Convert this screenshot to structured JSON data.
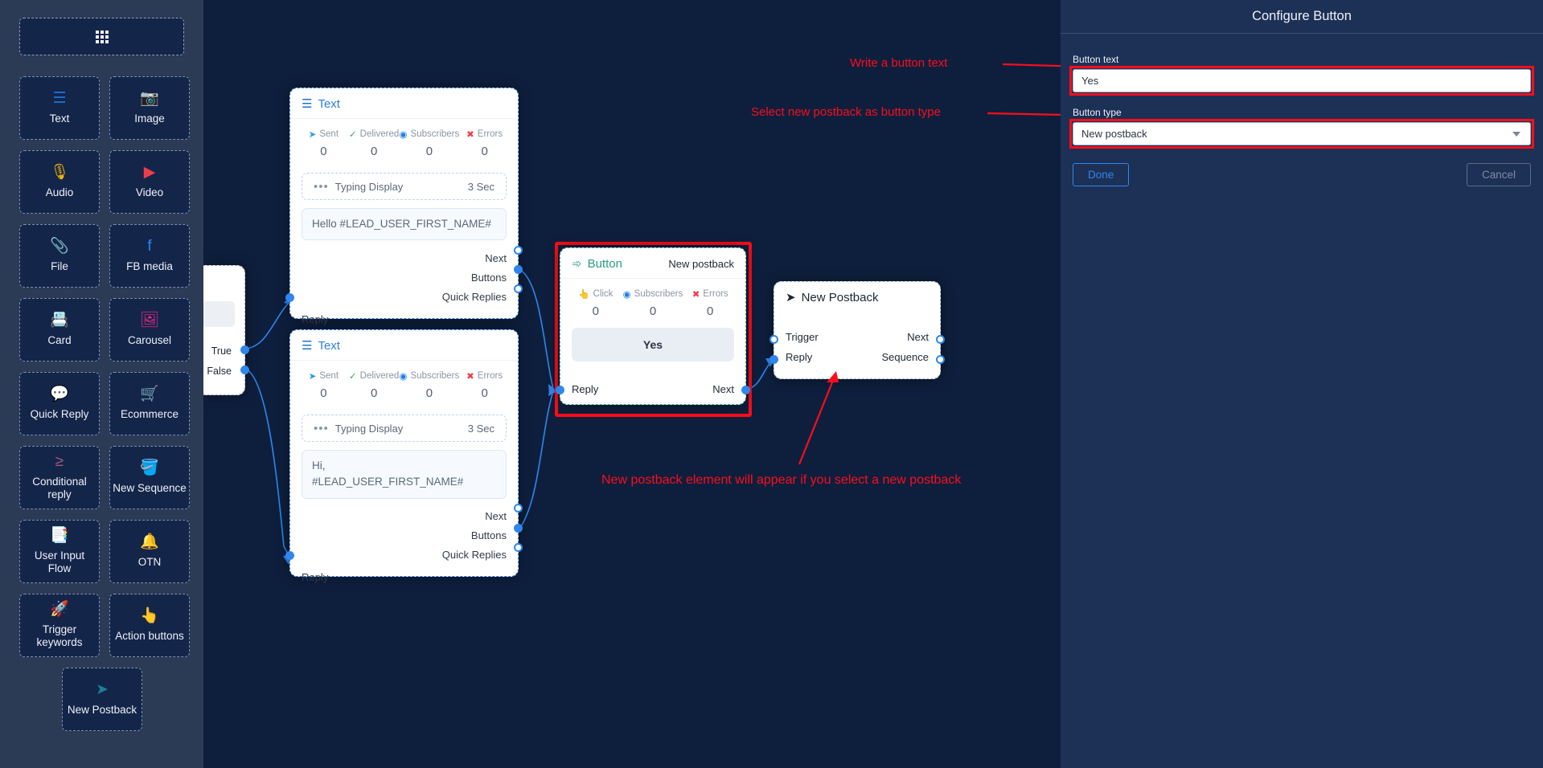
{
  "sidebar": {
    "grid_button_name": "apps-grid-icon",
    "tiles": [
      {
        "label": "Text",
        "icon": "☰",
        "color": "#1f6fd0",
        "name": "text"
      },
      {
        "label": "Image",
        "icon": "📷",
        "color": "#7b2ff7",
        "name": "image"
      },
      {
        "label": "Audio",
        "icon": "🎙",
        "color": "#f5b50a",
        "name": "audio"
      },
      {
        "label": "Video",
        "icon": "▶",
        "color": "#ef3e4a",
        "name": "video"
      },
      {
        "label": "File",
        "icon": "📎",
        "color": "#2fb14d",
        "name": "file"
      },
      {
        "label": "FB media",
        "icon": "f",
        "color": "#1d8bf1",
        "name": "fb-media"
      },
      {
        "label": "Card",
        "icon": "📇",
        "color": "#1fb6c9",
        "name": "card"
      },
      {
        "label": "Carousel",
        "icon": "🖼",
        "color": "#e5267f",
        "name": "carousel"
      },
      {
        "label": "Quick Reply",
        "icon": "💬",
        "color": "#d41f96",
        "name": "quick-reply"
      },
      {
        "label": "Ecommerce",
        "icon": "🛒",
        "color": "#f08008",
        "name": "ecommerce"
      },
      {
        "label": "Conditional reply",
        "icon": "≥",
        "color": "#a4577f",
        "name": "conditional-reply"
      },
      {
        "label": "New Sequence",
        "icon": "🪣",
        "color": "#d8232f",
        "name": "new-sequence"
      },
      {
        "label": "User Input Flow",
        "icon": "📑",
        "color": "#2fcf4d",
        "name": "user-input-flow"
      },
      {
        "label": "OTN",
        "icon": "🔔",
        "color": "#7a6df0",
        "name": "otn"
      },
      {
        "label": "Trigger keywords",
        "icon": "🚀",
        "color": "#1d2ce0",
        "name": "trigger-keywords"
      },
      {
        "label": "Action buttons",
        "icon": "👆",
        "color": "#f4786e",
        "name": "action-buttons"
      },
      {
        "label": "New Postback",
        "icon": "➤",
        "color": "#1d7f93",
        "name": "new-postback"
      }
    ]
  },
  "canvas": {
    "conditional_node": {
      "true_label": "True",
      "false_label": "False"
    },
    "text_node_1": {
      "title": "Text",
      "stats": [
        {
          "label": "Sent",
          "value": "0",
          "icon": "➤",
          "color": "#2f9ae0"
        },
        {
          "label": "Delivered",
          "value": "0",
          "icon": "✓",
          "color": "#2fb14d"
        },
        {
          "label": "Subscribers",
          "value": "0",
          "icon": "◉",
          "color": "#1d7fe0"
        },
        {
          "label": "Errors",
          "value": "0",
          "icon": "✖",
          "color": "#ef3e4a"
        }
      ],
      "typing_label": "Typing Display",
      "typing_value": "3 Sec",
      "message": "Hello #LEAD_USER_FIRST_NAME#",
      "ports_right": [
        "Next",
        "Buttons",
        "Quick Replies"
      ],
      "ports_left": [
        "Reply"
      ]
    },
    "text_node_2": {
      "title": "Text",
      "stats": [
        {
          "label": "Sent",
          "value": "0",
          "icon": "➤",
          "color": "#2f9ae0"
        },
        {
          "label": "Delivered",
          "value": "0",
          "icon": "✓",
          "color": "#2fb14d"
        },
        {
          "label": "Subscribers",
          "value": "0",
          "icon": "◉",
          "color": "#1d7fe0"
        },
        {
          "label": "Errors",
          "value": "0",
          "icon": "✖",
          "color": "#ef3e4a"
        }
      ],
      "typing_label": "Typing Display",
      "typing_value": "3 Sec",
      "message": "Hi,\n#LEAD_USER_FIRST_NAME#",
      "ports_right": [
        "Next",
        "Buttons",
        "Quick Replies"
      ],
      "ports_left": [
        "Reply"
      ]
    },
    "button_node": {
      "title": "Button",
      "badge": "New postback",
      "stats": [
        {
          "label": "Click",
          "value": "0",
          "icon": "👆",
          "color": "#5ab4e8"
        },
        {
          "label": "Subscribers",
          "value": "0",
          "icon": "◉",
          "color": "#1d7fe0"
        },
        {
          "label": "Errors",
          "value": "0",
          "icon": "✖",
          "color": "#ef3e4a"
        }
      ],
      "preview_label": "Yes",
      "port_left": "Reply",
      "port_right": "Next"
    },
    "postback_node": {
      "title": "New Postback",
      "rows": [
        {
          "left": "Trigger",
          "right": "Next"
        },
        {
          "left": "Reply",
          "right": "Sequence"
        }
      ]
    }
  },
  "panel": {
    "title": "Configure Button",
    "button_text_label": "Button text",
    "button_text_value": "Yes",
    "button_text_placeholder": "Button text",
    "button_type_label": "Button type",
    "button_type_value": "New postback",
    "done_label": "Done",
    "cancel_label": "Cancel"
  },
  "annotations": {
    "a1": "Write a button text",
    "a2": "Select new postback as button type",
    "a3": "New postback element will appear if you select a new postback"
  },
  "colors": {
    "accent_red": "#fc0d1b",
    "accent_blue": "#2f87ec",
    "accent_green": "#2aa081",
    "sidebar_bg": "#2b3a55",
    "canvas_bg": "#0e1f3d",
    "panel_bg": "#1d3055"
  }
}
